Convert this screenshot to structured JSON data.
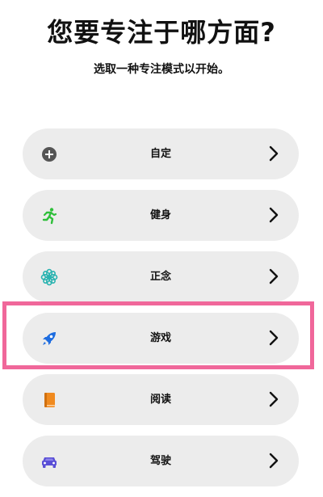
{
  "header": {
    "title": "您要专注于哪方面?",
    "subtitle": "选取一种专注模式以开始。"
  },
  "options": [
    {
      "label": "自定",
      "icon": "plus-circle-icon",
      "icon_color": "#555555"
    },
    {
      "label": "健身",
      "icon": "running-figure-icon",
      "icon_color": "#2fbf3a"
    },
    {
      "label": "正念",
      "icon": "flower-icon",
      "icon_color": "#2ab3b0"
    },
    {
      "label": "游戏",
      "icon": "rocket-icon",
      "icon_color": "#1e6de0"
    },
    {
      "label": "阅读",
      "icon": "book-icon",
      "icon_color": "#f08a1f"
    },
    {
      "label": "驾驶",
      "icon": "car-icon",
      "icon_color": "#5a4fd6"
    }
  ],
  "highlight": {
    "target": "游戏",
    "color": "#f0679a"
  }
}
